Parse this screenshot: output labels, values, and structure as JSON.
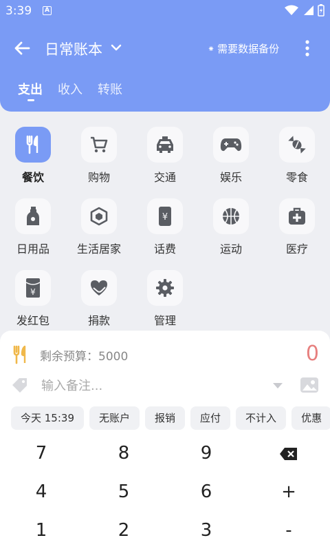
{
  "status_bar": {
    "time": "3:39",
    "notif_icon": "a-notification-icon"
  },
  "header": {
    "title": "日常账本",
    "backup_mark": "⁕",
    "backup_text": "需要数据备份",
    "tabs": [
      {
        "label": "支出",
        "active": true
      },
      {
        "label": "收入",
        "active": false
      },
      {
        "label": "转账",
        "active": false
      }
    ]
  },
  "categories": [
    {
      "label": "餐饮",
      "icon": "fork-knife-icon",
      "active": true
    },
    {
      "label": "购物",
      "icon": "cart-icon"
    },
    {
      "label": "交通",
      "icon": "taxi-icon"
    },
    {
      "label": "娱乐",
      "icon": "gamepad-icon"
    },
    {
      "label": "零食",
      "icon": "candy-icon"
    },
    {
      "label": "日用品",
      "icon": "bottle-icon"
    },
    {
      "label": "生活居家",
      "icon": "cube-icon"
    },
    {
      "label": "话费",
      "icon": "phone-yuan-icon"
    },
    {
      "label": "运动",
      "icon": "basketball-icon"
    },
    {
      "label": "医疗",
      "icon": "medkit-icon"
    },
    {
      "label": "发红包",
      "icon": "red-packet-icon"
    },
    {
      "label": "捐款",
      "icon": "heart-hand-icon"
    },
    {
      "label": "管理",
      "icon": "gear-icon"
    }
  ],
  "entry": {
    "budget_text": "剩余预算：5000",
    "amount": "0",
    "note_placeholder": "输入备注...",
    "chips": [
      "今天 15:39",
      "无账户",
      "报销",
      "应付",
      "不计入",
      "优惠"
    ]
  },
  "keypad": {
    "rows": [
      [
        "7",
        "8",
        "9",
        "⌫"
      ],
      [
        "4",
        "5",
        "6",
        "+"
      ],
      [
        "1",
        "2",
        "3",
        "-"
      ]
    ]
  },
  "colors": {
    "accent": "#7a9bf5",
    "amount": "#e7807f",
    "icon_gray": "#5a5d63"
  }
}
